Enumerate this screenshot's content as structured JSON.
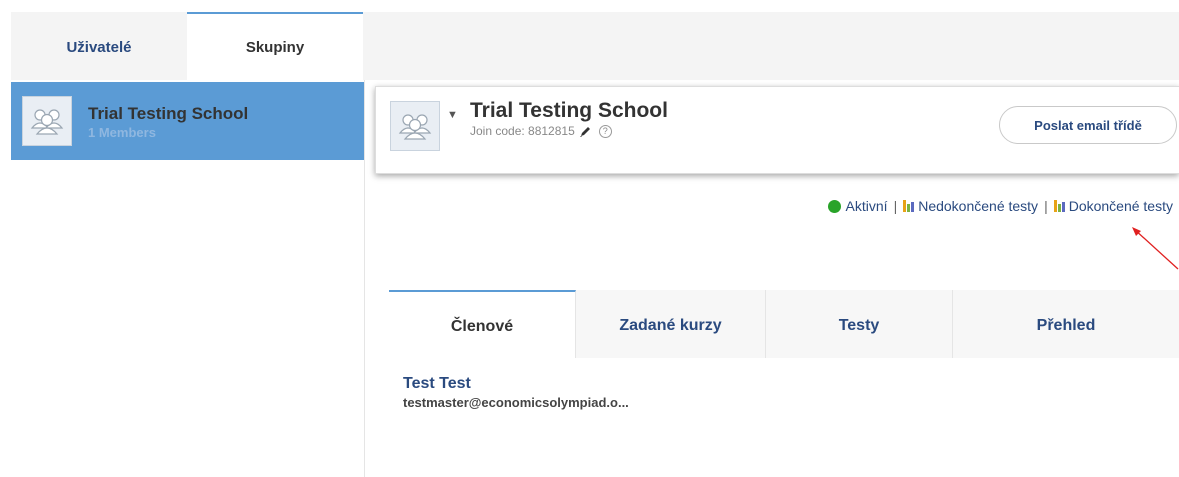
{
  "top_tabs": {
    "users": "Uživatelé",
    "groups": "Skupiny"
  },
  "sidebar": {
    "group": {
      "name": "Trial Testing School",
      "members": "1 Members"
    }
  },
  "header": {
    "title": "Trial Testing School",
    "join_code": "Join code: 8812815",
    "help": "?",
    "email_button": "Poslat email třídě"
  },
  "status": {
    "active": "Aktivní",
    "separator": "|",
    "unfinished": "Nedokončené testy",
    "finished": "Dokončené testy"
  },
  "tabs": [
    {
      "label": "Členové"
    },
    {
      "label": "Zadané kurzy"
    },
    {
      "label": "Testy"
    },
    {
      "label": "Přehled"
    }
  ],
  "members": [
    {
      "name": "Test Test",
      "email": "testmaster@economicsolympiad.o..."
    }
  ],
  "colors": {
    "accent": "#5b9bd5",
    "link": "#2a4a7f",
    "active_dot": "#29a329",
    "annotation": "#e02020"
  },
  "icons": {
    "group_avatar": "people-group-icon",
    "caret": "caret-down-icon",
    "edit": "pencil-icon",
    "help": "question-circle-icon",
    "active": "green-dot-icon",
    "tests": "bar-chart-icon"
  }
}
